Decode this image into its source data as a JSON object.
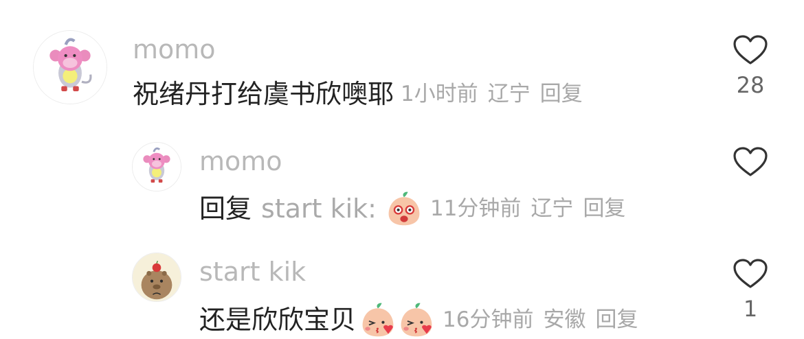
{
  "comments": [
    {
      "author": "momo",
      "text": "祝绪丹打给虞书欣噢耶",
      "time": "1小时前",
      "location": "辽宁",
      "reply_label": "回复",
      "likes": "28"
    },
    {
      "author": "momo",
      "reply_prefix": "回复",
      "mention": "start kik:",
      "time": "11分钟前",
      "location": "辽宁",
      "reply_label": "回复",
      "likes": ""
    },
    {
      "author": "start kik",
      "text": "还是欣欣宝贝",
      "time": "16分钟前",
      "location": "安徽",
      "reply_label": "回复",
      "likes": "1"
    }
  ],
  "icons": {
    "like": "heart-outline-icon",
    "emoji_surprised": "peach-surprised-emoji",
    "emoji_kiss": "peach-kiss-emoji"
  },
  "colors": {
    "author": "#b8b8b8",
    "meta": "#a8a8a8",
    "text": "#222222"
  }
}
